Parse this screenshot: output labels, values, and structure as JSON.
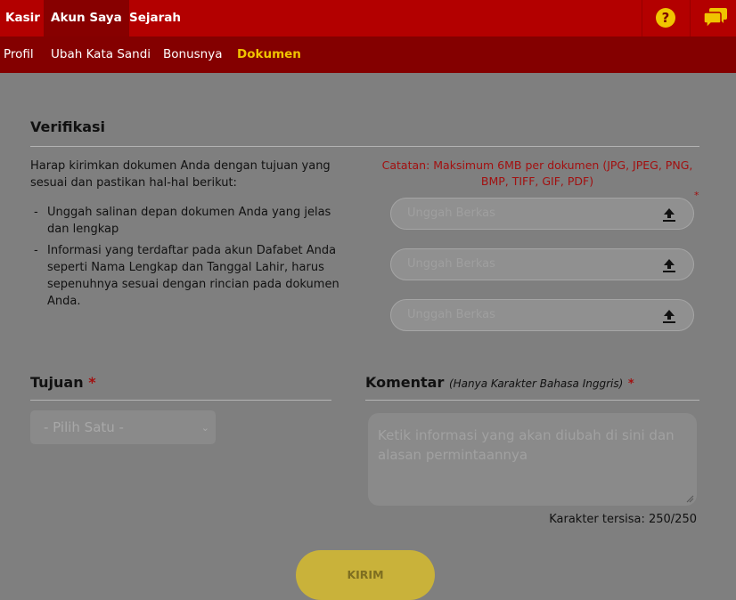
{
  "top_tabs": [
    "Kasir",
    "Akun Saya",
    "Sejarah"
  ],
  "help_icon_glyph": "?",
  "sub_tabs": [
    "Profil",
    "Ubah Kata Sandi",
    "Bonusnya",
    "Dokumen"
  ],
  "verification": {
    "title": "Verifikasi",
    "intro": "Harap kirimkan dokumen Anda dengan tujuan yang sesuai dan pastikan hal-hal berikut:",
    "bullets": [
      "Unggah salinan depan dokumen Anda yang jelas dan lengkap",
      "Informasi yang terdaftar pada akun Dafabet Anda seperti Nama Lengkap dan Tanggal Lahir, harus sepenuhnya sesuai dengan rincian pada dokumen Anda."
    ],
    "note": "Catatan: Maksimum 6MB per dokumen (JPG, JPEG, PNG, BMP, TIFF, GIF, PDF)",
    "required_mark": "*",
    "upload_placeholder": "Unggah Berkas"
  },
  "purpose": {
    "title": "Tujuan",
    "required_mark": "*",
    "select_value": "- Pilih Satu -"
  },
  "comment": {
    "title": "Komentar",
    "hint": "(Hanya Karakter Bahasa Inggris)",
    "required_mark": "*",
    "placeholder": "Ketik informasi yang akan diubah di sini dan alasan permintaannya",
    "char_count": "Karakter tersisa: 250/250"
  },
  "submit_label": "KIRIM",
  "colors": {
    "header_red": "#b30000",
    "subheader_red": "#840000",
    "active_tab": "#f0c400",
    "note_red": "#a21010",
    "submit_yellow": "#c9b23a"
  },
  "icons": [
    "help-icon",
    "chat-icon",
    "upload-icon",
    "chevron-down-icon",
    "resize-grip-icon"
  ]
}
